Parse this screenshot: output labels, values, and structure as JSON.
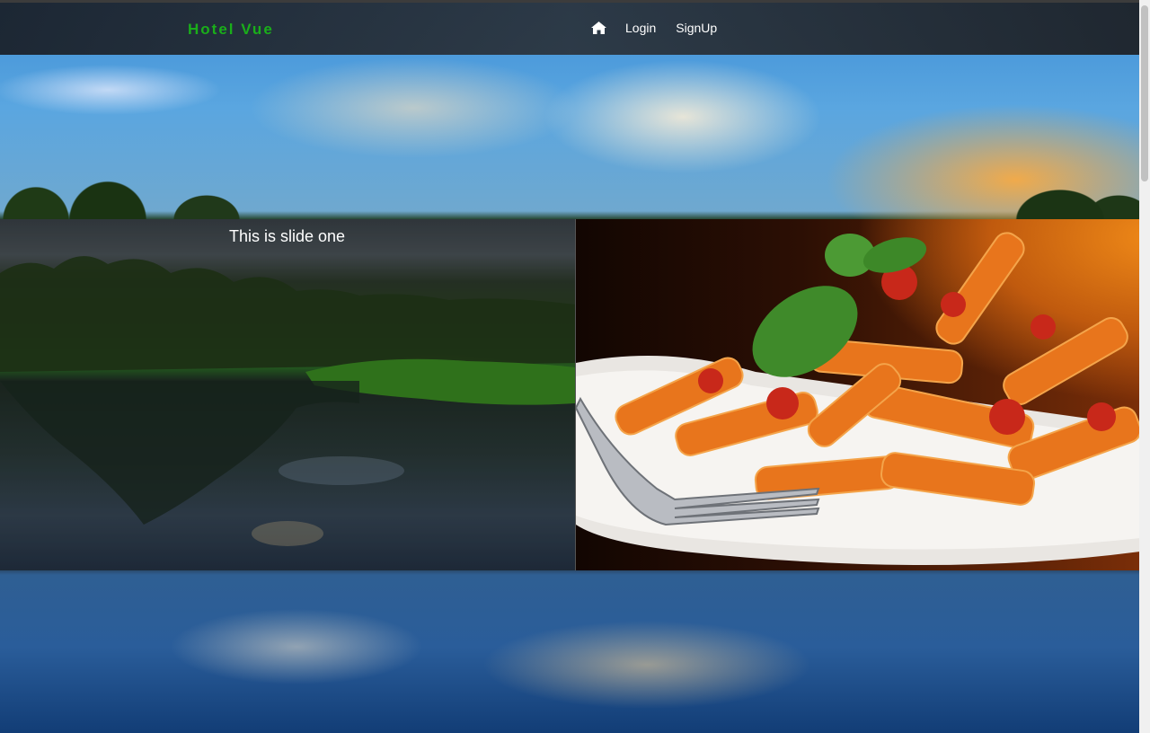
{
  "navbar": {
    "brand": "Hotel Vue",
    "home_icon": "home-icon",
    "links": [
      {
        "label": "Login"
      },
      {
        "label": "SignUp"
      }
    ]
  },
  "carousel": {
    "slides": [
      {
        "caption": "This is slide one",
        "image": "forest-lake-photo"
      },
      {
        "image": "pasta-plate-photo"
      }
    ]
  },
  "colors": {
    "brand": "#1aae1a",
    "navbar_bg": "#24272c",
    "nav_text": "#ffffff"
  }
}
